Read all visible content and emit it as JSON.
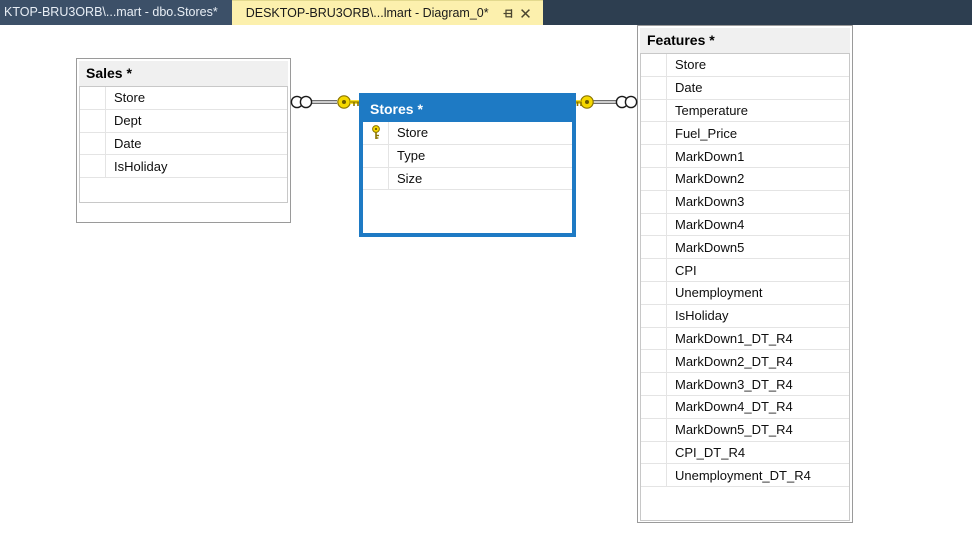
{
  "tabs": [
    {
      "label": "KTOP-BRU3ORB\\...mart - dbo.Stores*",
      "active": false,
      "name": "tab-dbo-stores"
    },
    {
      "label": "DESKTOP-BRU3ORB\\...lmart - Diagram_0*",
      "active": true,
      "name": "tab-diagram-0",
      "pin_icon": "pin-icon",
      "close_icon": "close-icon"
    }
  ],
  "colors": {
    "tabstrip_background": "#2d3e50",
    "active_tab_background": "#fcf0ad",
    "inactive_tab_background": "#3c5068",
    "selection_blue": "#1e7ac4",
    "table_header_grey": "#f0f0f0",
    "key_yellow": "#f5d800",
    "canvas_background": "#ffffff"
  },
  "diagram": {
    "tables": [
      {
        "name": "table-sales",
        "title": "Sales *",
        "selected": false,
        "columns": [
          {
            "label": "Store",
            "key": false
          },
          {
            "label": "Dept",
            "key": false
          },
          {
            "label": "Date",
            "key": false
          },
          {
            "label": "IsHoliday",
            "key": false
          }
        ]
      },
      {
        "name": "table-stores",
        "title": "Stores *",
        "selected": true,
        "columns": [
          {
            "label": "Store",
            "key": true,
            "key_icon": "key-icon"
          },
          {
            "label": "Type",
            "key": false
          },
          {
            "label": "Size",
            "key": false
          }
        ]
      },
      {
        "name": "table-features",
        "title": "Features *",
        "selected": false,
        "columns": [
          {
            "label": "Store",
            "key": false
          },
          {
            "label": "Date",
            "key": false
          },
          {
            "label": "Temperature",
            "key": false
          },
          {
            "label": "Fuel_Price",
            "key": false
          },
          {
            "label": "MarkDown1",
            "key": false
          },
          {
            "label": "MarkDown2",
            "key": false
          },
          {
            "label": "MarkDown3",
            "key": false
          },
          {
            "label": "MarkDown4",
            "key": false
          },
          {
            "label": "MarkDown5",
            "key": false
          },
          {
            "label": "CPI",
            "key": false
          },
          {
            "label": "Unemployment",
            "key": false
          },
          {
            "label": "IsHoliday",
            "key": false
          },
          {
            "label": "MarkDown1_DT_R4",
            "key": false
          },
          {
            "label": "MarkDown2_DT_R4",
            "key": false
          },
          {
            "label": "MarkDown3_DT_R4",
            "key": false
          },
          {
            "label": "MarkDown4_DT_R4",
            "key": false
          },
          {
            "label": "MarkDown5_DT_R4",
            "key": false
          },
          {
            "label": "CPI_DT_R4",
            "key": false
          },
          {
            "label": "Unemployment_DT_R4",
            "key": false
          }
        ]
      }
    ],
    "relationships": [
      {
        "name": "relationship-sales-stores",
        "from": "table-sales",
        "to": "table-stores",
        "from_cardinality": "many",
        "to_cardinality": "one-key"
      },
      {
        "name": "relationship-stores-features",
        "from": "table-stores",
        "to": "table-features",
        "from_cardinality": "one-key",
        "to_cardinality": "many"
      }
    ]
  }
}
